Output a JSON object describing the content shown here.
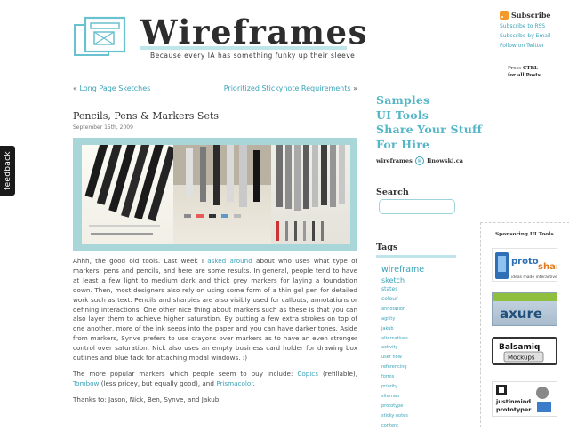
{
  "feedback": {
    "label": "feedback"
  },
  "header": {
    "title": "Wireframes",
    "tagline": "Because every IA has something funky up their sleeve"
  },
  "subscribe": {
    "heading": "Subscribe",
    "links": [
      "Subscribe to RSS",
      "Subscribe by Email",
      "Follow on Twitter"
    ],
    "hint_prefix": "Press",
    "hint_key": "CTRL",
    "hint_suffix": "for all Posts"
  },
  "post_nav": {
    "prev_arrow": "«",
    "prev": "Long Page Sketches",
    "next": "Prioritized Stickynote Requirements",
    "next_arrow": "»"
  },
  "post": {
    "title": "Pencils, Pens & Markers Sets",
    "date": "September 15th, 2009",
    "p1_before": "Ahhh, the good old tools. Last week I ",
    "p1_link": "asked around",
    "p1_after": " about who uses what type of markers, pens and pencils, and here are some results. In general, people tend to have at least a few light to medium dark and thick grey markers for laying a foundation down. Then, most designers also rely on using some form of a thin gel pen for detailed work such as text. Pencils and sharpies are also visibly used for callouts, annotations or defining interactions. One other nice thing about markers such as these is that you can also layer them to achieve higher saturation. By putting a few extra strokes on top of one another, more of the ink seeps into the paper and you can have darker tones. Aside from markers, Synve prefers to use crayons over markers as to have an even stronger control over saturation. Nick also uses an empty business card holder for drawing box outlines and blue tack for attaching modal windows. :)",
    "p2_intro": "The more popular markers which people seem to buy include: ",
    "p2_copics": "Copics",
    "p2_copics_note": " (refillable), ",
    "p2_tombow": "Tombow",
    "p2_tombow_note": " (less pricey, but equally good), and ",
    "p2_prisma": "Prismacolor",
    "p2_end": ".",
    "p3": "Thanks to: Jason, Nick, Ben, Synve, and Jakub"
  },
  "nav": {
    "items": [
      "Samples",
      "UI Tools",
      "Share Your Stuff",
      "For Hire"
    ]
  },
  "credit": {
    "left": "wireframes",
    "at": "@",
    "right": "linowski.ca"
  },
  "search": {
    "heading": "Search",
    "placeholder": ""
  },
  "tags": {
    "heading": "Tags",
    "items": [
      {
        "label": "wireframe",
        "size": 9.5
      },
      {
        "label": "sketch",
        "size": 8
      },
      {
        "label": "states",
        "size": 6
      },
      {
        "label": "colour",
        "size": 6
      },
      {
        "label": "annotation",
        "size": 5
      },
      {
        "label": "agility",
        "size": 5
      },
      {
        "label": "jakub",
        "size": 5
      },
      {
        "label": "alternatives",
        "size": 5
      },
      {
        "label": "activity",
        "size": 5
      },
      {
        "label": "user flow",
        "size": 5
      },
      {
        "label": "referencing",
        "size": 5
      },
      {
        "label": "forms",
        "size": 5
      },
      {
        "label": "priority",
        "size": 5
      },
      {
        "label": "sitemap",
        "size": 5
      },
      {
        "label": "prototype",
        "size": 5
      },
      {
        "label": "sticky notes",
        "size": 5
      },
      {
        "label": "content",
        "size": 5
      }
    ]
  },
  "sponsors": {
    "heading": "Sponsoring UI Tools",
    "protoshare_left": "proto",
    "protoshare_right": "share",
    "protoshare_tagline": "ideas made interactive",
    "axure": "axure",
    "balsamiq_1": "Balsamiq",
    "balsamiq_2": "Mockups",
    "jim_1": "justinmind",
    "jim_2": "prototyper"
  },
  "colors": {
    "accent": "#54b6c7",
    "link": "#3ba3b8",
    "image_frame": "#a9d6d9",
    "rss": "#f39a2a"
  }
}
